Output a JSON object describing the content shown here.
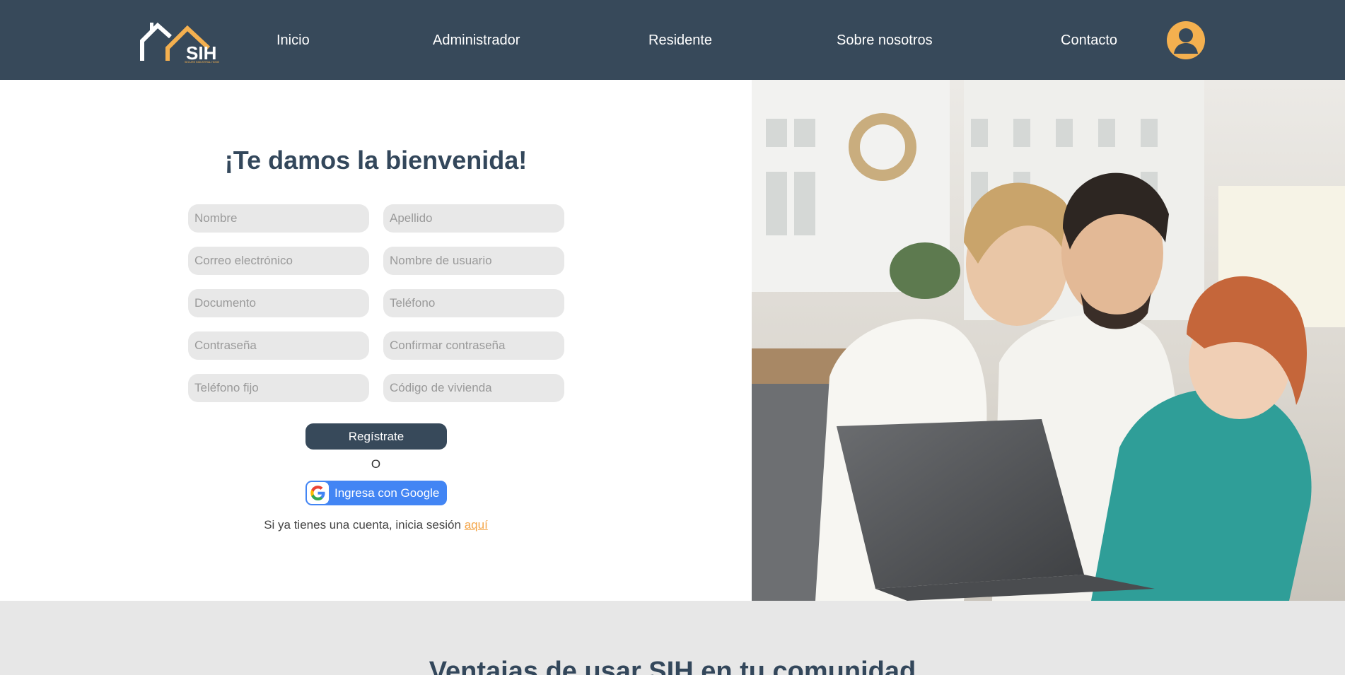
{
  "brand": {
    "logo_text": "SIH",
    "logo_tagline": "SECURE INDUSTRIAL HOME",
    "colors": {
      "navy": "#37495a",
      "accent": "#f4b04f",
      "google_blue": "#4285f4",
      "field_bg": "#e8e8e8"
    }
  },
  "nav": {
    "items": [
      {
        "label": "Inicio"
      },
      {
        "label": "Administrador"
      },
      {
        "label": "Residente"
      },
      {
        "label": "Sobre nosotros"
      },
      {
        "label": "Contacto"
      }
    ],
    "avatar_icon": "user-circle-icon"
  },
  "register": {
    "title": "¡Te damos la bienvenida!",
    "fields": {
      "nombre": {
        "placeholder": "Nombre",
        "value": ""
      },
      "apellido": {
        "placeholder": "Apellido",
        "value": ""
      },
      "correo": {
        "placeholder": "Correo electrónico",
        "value": ""
      },
      "usuario": {
        "placeholder": "Nombre de usuario",
        "value": ""
      },
      "documento": {
        "placeholder": "Documento",
        "value": ""
      },
      "telefono": {
        "placeholder": "Teléfono",
        "value": ""
      },
      "contrasena": {
        "placeholder": "Contraseña",
        "value": ""
      },
      "confirmar": {
        "placeholder": "Confirmar contraseña",
        "value": ""
      },
      "telefono_fijo": {
        "placeholder": "Teléfono fijo",
        "value": ""
      },
      "codigo_vivienda": {
        "placeholder": "Código de vivienda",
        "value": ""
      }
    },
    "submit_label": "Regístrate",
    "or_text": "O",
    "google_label": "Ingresa con Google",
    "google_icon": "google-g-icon",
    "login_prompt": "Si ya tienes una cuenta, inicia sesión",
    "login_link": "aquí"
  },
  "hero_image": {
    "description_icon": "family-laptop-photo"
  },
  "benefits": {
    "title": "Ventajas de usar SIH en tu comunidad"
  }
}
